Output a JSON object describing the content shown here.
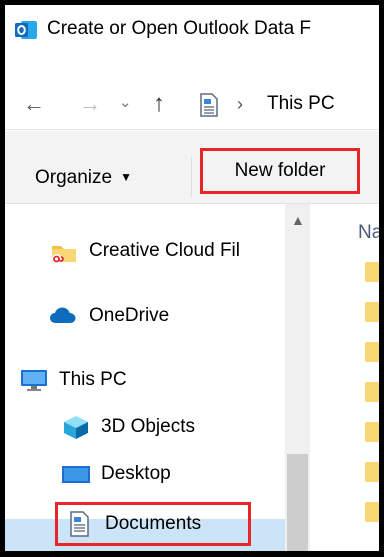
{
  "window": {
    "title": "Create or Open Outlook Data F"
  },
  "address": {
    "location": "This PC"
  },
  "toolbar": {
    "organize_label": "Organize",
    "new_folder_label": "New folder"
  },
  "sidebar": {
    "items": [
      {
        "label": "Creative Cloud Fil",
        "icon": "creative-cloud-icon"
      },
      {
        "label": "OneDrive",
        "icon": "onedrive-cloud-icon"
      },
      {
        "label": "This PC",
        "icon": "computer-icon"
      },
      {
        "label": "3D Objects",
        "icon": "cube-icon"
      },
      {
        "label": "Desktop",
        "icon": "desktop-icon"
      },
      {
        "label": "Documents",
        "icon": "document-icon",
        "selected": true
      }
    ]
  },
  "content": {
    "column_header": "Na"
  },
  "colors": {
    "highlight_box": "#e8262a",
    "selection": "#cce4f7",
    "outlook_blue": "#0f6cbd",
    "folder": "#f8d775"
  }
}
